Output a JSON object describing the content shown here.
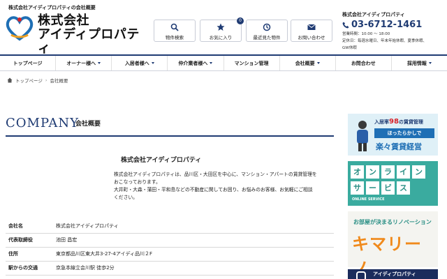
{
  "top_strip": "株式会社アイディプロパティの会社概要",
  "logo": {
    "line1": "株式会社",
    "line2": "アイディプロパティ"
  },
  "header_buttons": [
    {
      "label": "物件検索",
      "icon": "search-icon"
    },
    {
      "label": "お気に入り",
      "icon": "star-icon",
      "badge": "0"
    },
    {
      "label": "最近見た物件",
      "icon": "history-icon"
    },
    {
      "label": "お問い合わせ",
      "icon": "mail-icon"
    }
  ],
  "contact": {
    "company": "株式会社アイディプロパティ",
    "tel": "03-6712-1461",
    "hours": "営業時間：10:00 ～ 18:00",
    "holiday": "定休日：毎週水曜日、年末年始休暇、夏季休暇、",
    "holiday2": "GW休暇"
  },
  "nav": [
    "トップページ",
    "オーナー様へ",
    "入居者様へ",
    "仲介業者様へ",
    "マンション管理",
    "会社概要",
    "お問合わせ",
    "採用情報"
  ],
  "breadcrumb": {
    "home": "トップページ",
    "current": "会社概要"
  },
  "heading": {
    "en": "COMPANY",
    "ja": "会社概要"
  },
  "company_title": "株式会社アイディプロパティ",
  "intro": {
    "line1": "株式会社アイディプロパティは、品川区・大田区を中心に、マンション・アパートの賃貸管理を",
    "line2": "おこなっております。",
    "line3": "大井町・大森・蒲田・平和島などの不動産に関してお困り、お悩みのお客様、お気軽にご相談",
    "line4": "ください。"
  },
  "info_table": [
    {
      "key": "会社名",
      "value": "株式会社アイディプロパティ"
    },
    {
      "key": "代表取締役",
      "value": "池田 昌宏"
    },
    {
      "key": "住所",
      "value": "東京都品川区東大井3-27-4アイディ品川２F"
    },
    {
      "key": "駅からの交通",
      "value": "京急本線立会川駅 徒歩2分"
    }
  ],
  "banners": {
    "b1_top": "入居率",
    "b1_rate": "98",
    "b1_top2": "の賃貸管理",
    "b1_box": "ほったらかしで",
    "b1_big": "楽々賃貸経営",
    "b2_row1": [
      "オ",
      "ン",
      "ラ",
      "イ",
      "ン"
    ],
    "b2_row2": [
      "サ",
      "ー",
      "ビ",
      "ス"
    ],
    "b2_sub": "ONLINE SERVICE",
    "b3_top": "お部屋が決まるリノベーション",
    "b3_big": "キマリーノ",
    "b4_text": "アイディプロパティ"
  },
  "colors": {
    "brand": "#1f3b73",
    "teal": "#3aab9f",
    "orange": "#f08a1c",
    "red": "#d8232a"
  }
}
